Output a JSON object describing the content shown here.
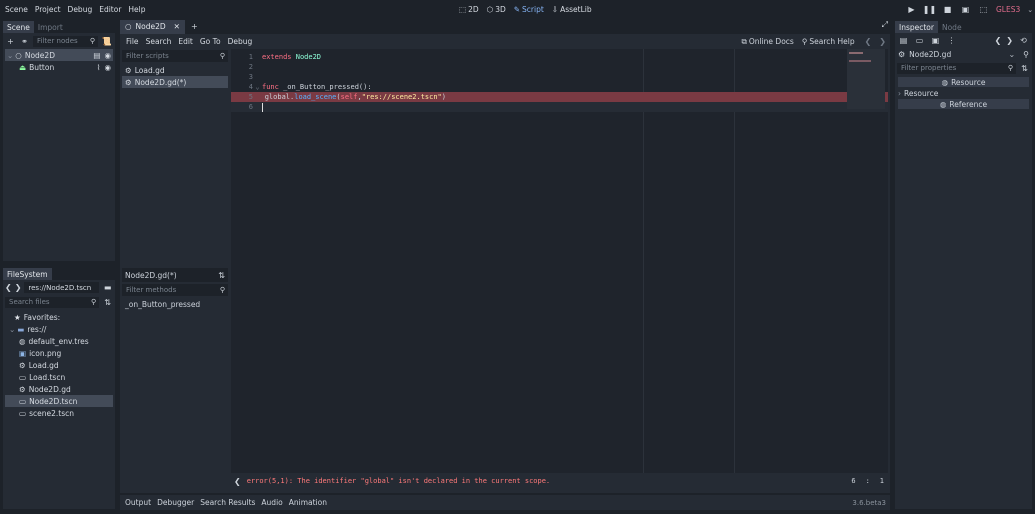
{
  "menubar": {
    "items": [
      "Scene",
      "Project",
      "Debug",
      "Editor",
      "Help"
    ],
    "modes": [
      {
        "label": "2D",
        "icon": "2d-icon"
      },
      {
        "label": "3D",
        "icon": "3d-icon"
      },
      {
        "label": "Script",
        "icon": "script-icon",
        "active": true
      },
      {
        "label": "AssetLib",
        "icon": "assetlib-icon"
      }
    ],
    "renderer": "GLES3"
  },
  "scene_dock": {
    "tabs": [
      "Scene",
      "Import"
    ],
    "filter_placeholder": "Filter nodes",
    "nodes": [
      {
        "label": "Node2D",
        "selected": true
      },
      {
        "label": "Button",
        "selected": false
      }
    ]
  },
  "filesystem_dock": {
    "tab": "FileSystem",
    "path": "res://Node2D.tscn",
    "search_placeholder": "Search files",
    "items": [
      {
        "label": "Favorites:",
        "icon": "star-icon",
        "indent": 1
      },
      {
        "label": "res://",
        "icon": "folder-icon",
        "indent": 0
      },
      {
        "label": "default_env.tres",
        "icon": "resource-icon",
        "indent": 2
      },
      {
        "label": "icon.png",
        "icon": "image-icon",
        "indent": 2
      },
      {
        "label": "Load.gd",
        "icon": "gear-icon",
        "indent": 2
      },
      {
        "label": "Load.tscn",
        "icon": "scene-icon",
        "indent": 2
      },
      {
        "label": "Node2D.gd",
        "icon": "gear-icon",
        "indent": 2
      },
      {
        "label": "Node2D.tscn",
        "icon": "scene-icon",
        "indent": 2,
        "selected": true
      },
      {
        "label": "scene2.tscn",
        "icon": "scene-icon",
        "indent": 2
      }
    ]
  },
  "editor": {
    "scene_tab": "Node2D",
    "menu": [
      "File",
      "Search",
      "Edit",
      "Go To",
      "Debug"
    ],
    "online_docs": "Online Docs",
    "search_help": "Search Help",
    "filter_scripts_placeholder": "Filter scripts",
    "scripts": [
      {
        "label": "Load.gd",
        "selected": false
      },
      {
        "label": "Node2D.gd(*)",
        "selected": true
      }
    ],
    "methods_title": "Node2D.gd(*)",
    "filter_methods_placeholder": "Filter methods",
    "methods": [
      "_on_Button_pressed"
    ],
    "code_lines": [
      {
        "n": "1",
        "parts": [
          [
            "kw",
            "extends"
          ],
          [
            "txt",
            " "
          ],
          [
            "ty",
            "Node2D"
          ]
        ]
      },
      {
        "n": "2",
        "parts": []
      },
      {
        "n": "3",
        "parts": []
      },
      {
        "n": "4",
        "parts": [
          [
            "kw",
            "func"
          ],
          [
            "txt",
            " _on_Button_pressed():"
          ]
        ],
        "fold": true
      },
      {
        "n": "5",
        "parts": [
          [
            "txt",
            "\tglobal."
          ],
          [
            "fn",
            "load_scene"
          ],
          [
            "txt",
            "("
          ],
          [
            "kw",
            "self"
          ],
          [
            "txt",
            ","
          ],
          [
            "st",
            "\"res://scene2.tscn\""
          ],
          [
            "txt",
            ")"
          ]
        ],
        "error": true
      },
      {
        "n": "6",
        "parts": [],
        "current": true
      }
    ],
    "error_text": "error(5,1): The identifier \"global\" isn't declared in the current scope.",
    "cursor_line": "6",
    "cursor_col": "1"
  },
  "bottom_panel": {
    "tabs": [
      "Output",
      "Debugger",
      "Search Results",
      "Audio",
      "Animation"
    ],
    "version": "3.6.beta3"
  },
  "inspector": {
    "tabs": [
      "Inspector",
      "Node"
    ],
    "object": "Node2D.gd",
    "filter_placeholder": "Filter properties",
    "resource_header": "Resource",
    "resource_section": "Resource",
    "reference_header": "Reference"
  },
  "colors": {
    "accent": "#86b4f5",
    "error_line": "#7a3a43",
    "error_text": "#ff7a7a",
    "renderer": "#e06c8c"
  }
}
